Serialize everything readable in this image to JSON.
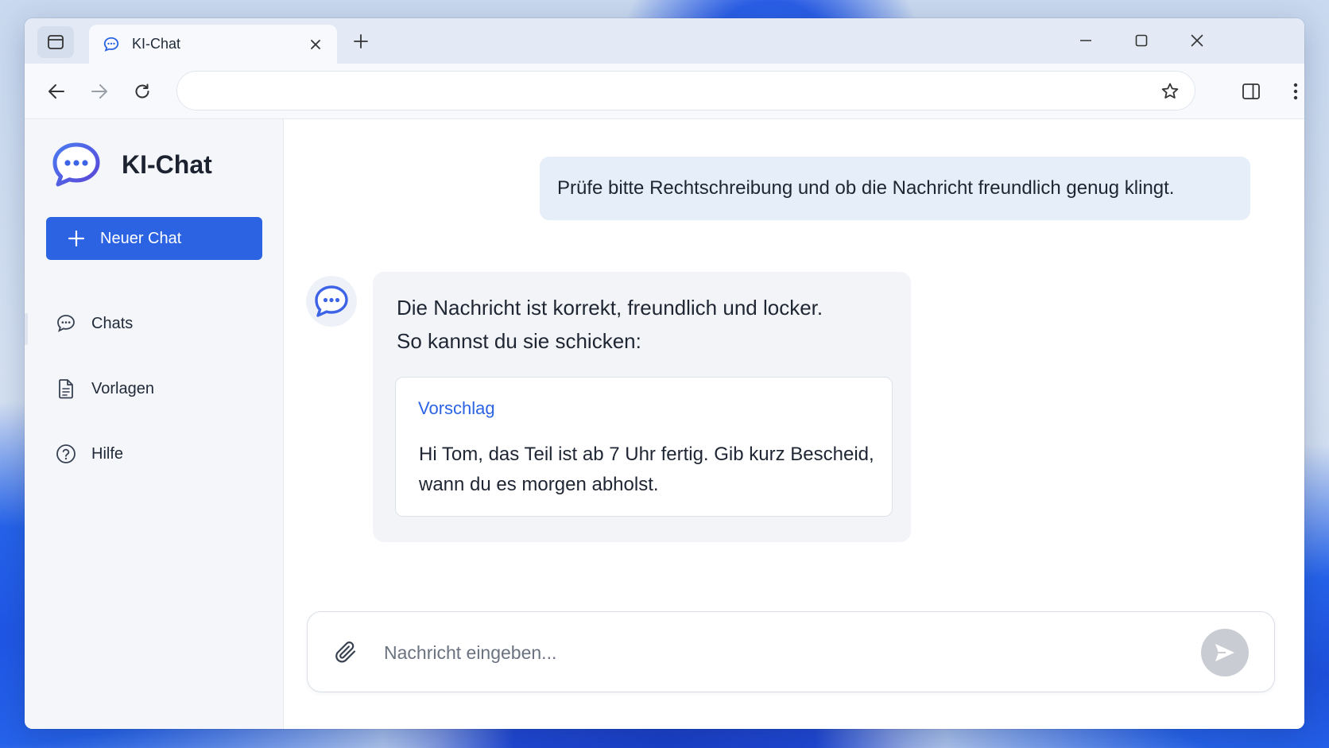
{
  "browser": {
    "tab": {
      "title": "KI-Chat",
      "icon": "chat-bubble-icon"
    },
    "address": {
      "value": ""
    },
    "icons": {
      "tab_panel": "tab-panel-icon",
      "close_tab": "close-icon",
      "new_tab": "plus-icon",
      "minimize": "minimize-icon",
      "maximize": "maximize-icon",
      "close_window": "close-icon",
      "back": "back-arrow-icon",
      "forward": "forward-arrow-icon",
      "reload": "reload-icon",
      "bookmark": "star-icon",
      "side_panel": "side-panel-icon",
      "menu": "kebab-menu-icon"
    }
  },
  "sidebar": {
    "brand_title": "KI-Chat",
    "new_chat_label": "Neuer Chat",
    "items": [
      {
        "label": "Chats",
        "icon": "chat-bubble-icon",
        "active": true
      },
      {
        "label": "Vorlagen",
        "icon": "document-icon",
        "active": false
      },
      {
        "label": "Hilfe",
        "icon": "help-circle-icon",
        "active": false
      }
    ]
  },
  "chat": {
    "user_message": "Prüfe bitte Rechtschreibung und ob die Nachricht freundlich genug klingt.",
    "assistant_line1": "Die Nachricht ist korrekt, freundlich und locker.",
    "assistant_line2": "So kannst du sie schicken:",
    "suggestion_title": "Vorschlag",
    "suggestion_text": "Hi Tom, das Teil ist ab 7 Uhr fertig. Gib kurz Bescheid, wann du es morgen abholst."
  },
  "composer": {
    "placeholder": "Nachricht eingeben...",
    "value": ""
  },
  "colors": {
    "accent": "#2b63e3",
    "user_bubble": "#e6eefa",
    "assistant_bubble": "#f3f4f7",
    "send_disabled": "#c9ccd2"
  }
}
